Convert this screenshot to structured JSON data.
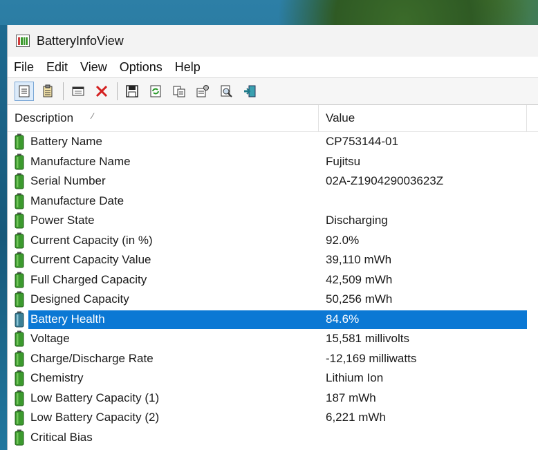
{
  "window": {
    "title": "BatteryInfoView"
  },
  "menu": [
    "File",
    "Edit",
    "Options",
    "Help",
    "View"
  ],
  "menu_order": [
    "File",
    "Edit",
    "View",
    "Options",
    "Help"
  ],
  "toolbar": {
    "buttons": [
      "properties-icon",
      "clipboard-icon",
      "window-icon",
      "delete-icon",
      "save-icon",
      "refresh-icon",
      "copy-icon",
      "settings-icon",
      "find-icon",
      "exit-icon"
    ]
  },
  "columns": {
    "description": "Description",
    "value": "Value"
  },
  "rows": [
    {
      "label": "Battery Name",
      "value": "CP753144-01"
    },
    {
      "label": "Manufacture Name",
      "value": "Fujitsu"
    },
    {
      "label": "Serial Number",
      "value": "02A-Z190429003623Z"
    },
    {
      "label": "Manufacture Date",
      "value": ""
    },
    {
      "label": "Power State",
      "value": "Discharging"
    },
    {
      "label": "Current Capacity (in %)",
      "value": "92.0%"
    },
    {
      "label": "Current Capacity Value",
      "value": "39,110 mWh"
    },
    {
      "label": "Full Charged Capacity",
      "value": "42,509 mWh"
    },
    {
      "label": "Designed Capacity",
      "value": "50,256 mWh"
    },
    {
      "label": "Battery Health",
      "value": "84.6%"
    },
    {
      "label": "Voltage",
      "value": "15,581 millivolts"
    },
    {
      "label": "Charge/Discharge Rate",
      "value": "-12,169 milliwatts"
    },
    {
      "label": "Chemistry",
      "value": "Lithium Ion"
    },
    {
      "label": "Low Battery Capacity (1)",
      "value": "187 mWh"
    },
    {
      "label": "Low Battery Capacity (2)",
      "value": "6,221 mWh"
    },
    {
      "label": "Critical Bias",
      "value": ""
    }
  ],
  "selected_row": "Battery Health",
  "colors": {
    "selection": "#0b78d4",
    "battery_green": "#3c9a2e"
  }
}
